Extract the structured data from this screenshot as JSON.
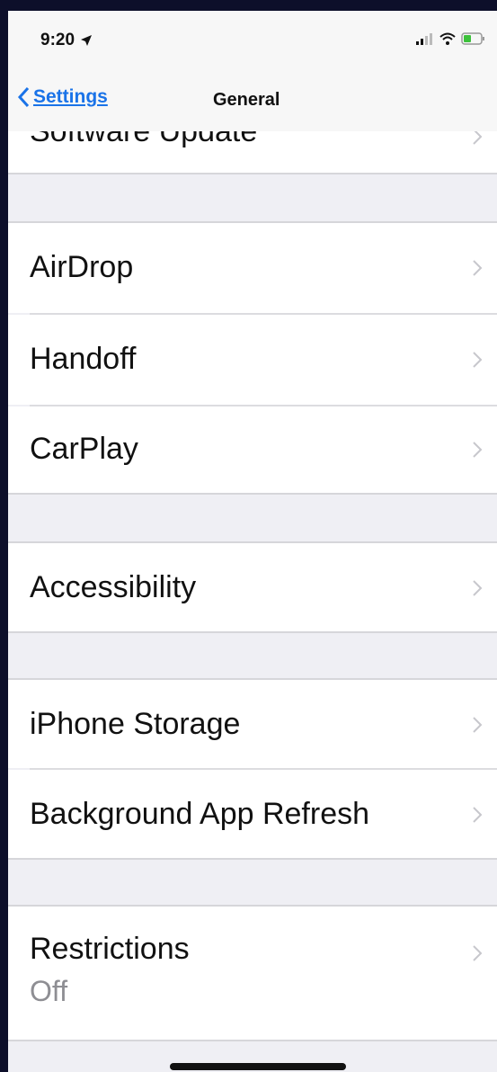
{
  "status_bar": {
    "time": "9:20",
    "location_icon": "location-arrow-icon",
    "signal_icon": "cellular-signal-icon",
    "wifi_icon": "wifi-icon",
    "battery_icon": "battery-icon"
  },
  "nav": {
    "back_label": "Settings",
    "title": "General",
    "accent_color": "#1a73e8"
  },
  "rows": [
    {
      "label": "Software Update"
    },
    {
      "label": "AirDrop"
    },
    {
      "label": "Handoff"
    },
    {
      "label": "CarPlay"
    },
    {
      "label": "Accessibility"
    },
    {
      "label": "iPhone Storage"
    },
    {
      "label": "Background App Refresh"
    },
    {
      "label": "Restrictions",
      "value": "Off"
    }
  ]
}
